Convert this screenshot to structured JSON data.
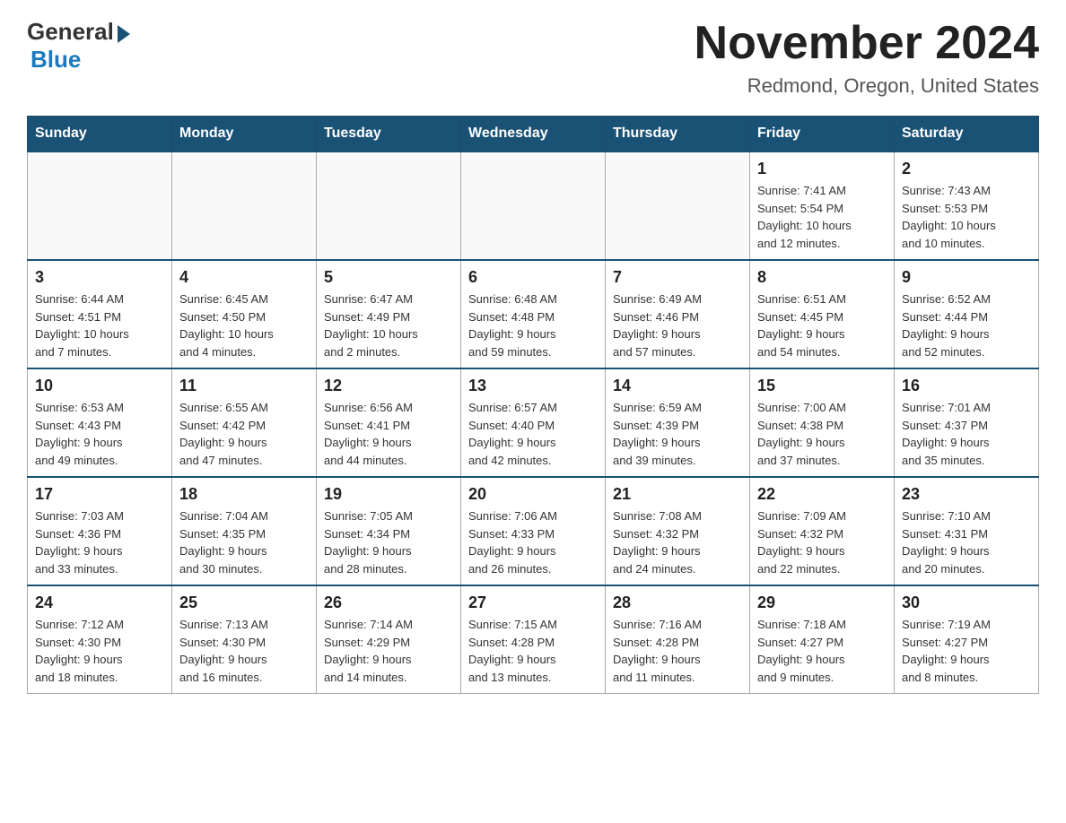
{
  "logo": {
    "general": "General",
    "blue": "Blue"
  },
  "title": "November 2024",
  "subtitle": "Redmond, Oregon, United States",
  "days_of_week": [
    "Sunday",
    "Monday",
    "Tuesday",
    "Wednesday",
    "Thursday",
    "Friday",
    "Saturday"
  ],
  "weeks": [
    [
      {
        "day": "",
        "info": ""
      },
      {
        "day": "",
        "info": ""
      },
      {
        "day": "",
        "info": ""
      },
      {
        "day": "",
        "info": ""
      },
      {
        "day": "",
        "info": ""
      },
      {
        "day": "1",
        "info": "Sunrise: 7:41 AM\nSunset: 5:54 PM\nDaylight: 10 hours\nand 12 minutes."
      },
      {
        "day": "2",
        "info": "Sunrise: 7:43 AM\nSunset: 5:53 PM\nDaylight: 10 hours\nand 10 minutes."
      }
    ],
    [
      {
        "day": "3",
        "info": "Sunrise: 6:44 AM\nSunset: 4:51 PM\nDaylight: 10 hours\nand 7 minutes."
      },
      {
        "day": "4",
        "info": "Sunrise: 6:45 AM\nSunset: 4:50 PM\nDaylight: 10 hours\nand 4 minutes."
      },
      {
        "day": "5",
        "info": "Sunrise: 6:47 AM\nSunset: 4:49 PM\nDaylight: 10 hours\nand 2 minutes."
      },
      {
        "day": "6",
        "info": "Sunrise: 6:48 AM\nSunset: 4:48 PM\nDaylight: 9 hours\nand 59 minutes."
      },
      {
        "day": "7",
        "info": "Sunrise: 6:49 AM\nSunset: 4:46 PM\nDaylight: 9 hours\nand 57 minutes."
      },
      {
        "day": "8",
        "info": "Sunrise: 6:51 AM\nSunset: 4:45 PM\nDaylight: 9 hours\nand 54 minutes."
      },
      {
        "day": "9",
        "info": "Sunrise: 6:52 AM\nSunset: 4:44 PM\nDaylight: 9 hours\nand 52 minutes."
      }
    ],
    [
      {
        "day": "10",
        "info": "Sunrise: 6:53 AM\nSunset: 4:43 PM\nDaylight: 9 hours\nand 49 minutes."
      },
      {
        "day": "11",
        "info": "Sunrise: 6:55 AM\nSunset: 4:42 PM\nDaylight: 9 hours\nand 47 minutes."
      },
      {
        "day": "12",
        "info": "Sunrise: 6:56 AM\nSunset: 4:41 PM\nDaylight: 9 hours\nand 44 minutes."
      },
      {
        "day": "13",
        "info": "Sunrise: 6:57 AM\nSunset: 4:40 PM\nDaylight: 9 hours\nand 42 minutes."
      },
      {
        "day": "14",
        "info": "Sunrise: 6:59 AM\nSunset: 4:39 PM\nDaylight: 9 hours\nand 39 minutes."
      },
      {
        "day": "15",
        "info": "Sunrise: 7:00 AM\nSunset: 4:38 PM\nDaylight: 9 hours\nand 37 minutes."
      },
      {
        "day": "16",
        "info": "Sunrise: 7:01 AM\nSunset: 4:37 PM\nDaylight: 9 hours\nand 35 minutes."
      }
    ],
    [
      {
        "day": "17",
        "info": "Sunrise: 7:03 AM\nSunset: 4:36 PM\nDaylight: 9 hours\nand 33 minutes."
      },
      {
        "day": "18",
        "info": "Sunrise: 7:04 AM\nSunset: 4:35 PM\nDaylight: 9 hours\nand 30 minutes."
      },
      {
        "day": "19",
        "info": "Sunrise: 7:05 AM\nSunset: 4:34 PM\nDaylight: 9 hours\nand 28 minutes."
      },
      {
        "day": "20",
        "info": "Sunrise: 7:06 AM\nSunset: 4:33 PM\nDaylight: 9 hours\nand 26 minutes."
      },
      {
        "day": "21",
        "info": "Sunrise: 7:08 AM\nSunset: 4:32 PM\nDaylight: 9 hours\nand 24 minutes."
      },
      {
        "day": "22",
        "info": "Sunrise: 7:09 AM\nSunset: 4:32 PM\nDaylight: 9 hours\nand 22 minutes."
      },
      {
        "day": "23",
        "info": "Sunrise: 7:10 AM\nSunset: 4:31 PM\nDaylight: 9 hours\nand 20 minutes."
      }
    ],
    [
      {
        "day": "24",
        "info": "Sunrise: 7:12 AM\nSunset: 4:30 PM\nDaylight: 9 hours\nand 18 minutes."
      },
      {
        "day": "25",
        "info": "Sunrise: 7:13 AM\nSunset: 4:30 PM\nDaylight: 9 hours\nand 16 minutes."
      },
      {
        "day": "26",
        "info": "Sunrise: 7:14 AM\nSunset: 4:29 PM\nDaylight: 9 hours\nand 14 minutes."
      },
      {
        "day": "27",
        "info": "Sunrise: 7:15 AM\nSunset: 4:28 PM\nDaylight: 9 hours\nand 13 minutes."
      },
      {
        "day": "28",
        "info": "Sunrise: 7:16 AM\nSunset: 4:28 PM\nDaylight: 9 hours\nand 11 minutes."
      },
      {
        "day": "29",
        "info": "Sunrise: 7:18 AM\nSunset: 4:27 PM\nDaylight: 9 hours\nand 9 minutes."
      },
      {
        "day": "30",
        "info": "Sunrise: 7:19 AM\nSunset: 4:27 PM\nDaylight: 9 hours\nand 8 minutes."
      }
    ]
  ]
}
